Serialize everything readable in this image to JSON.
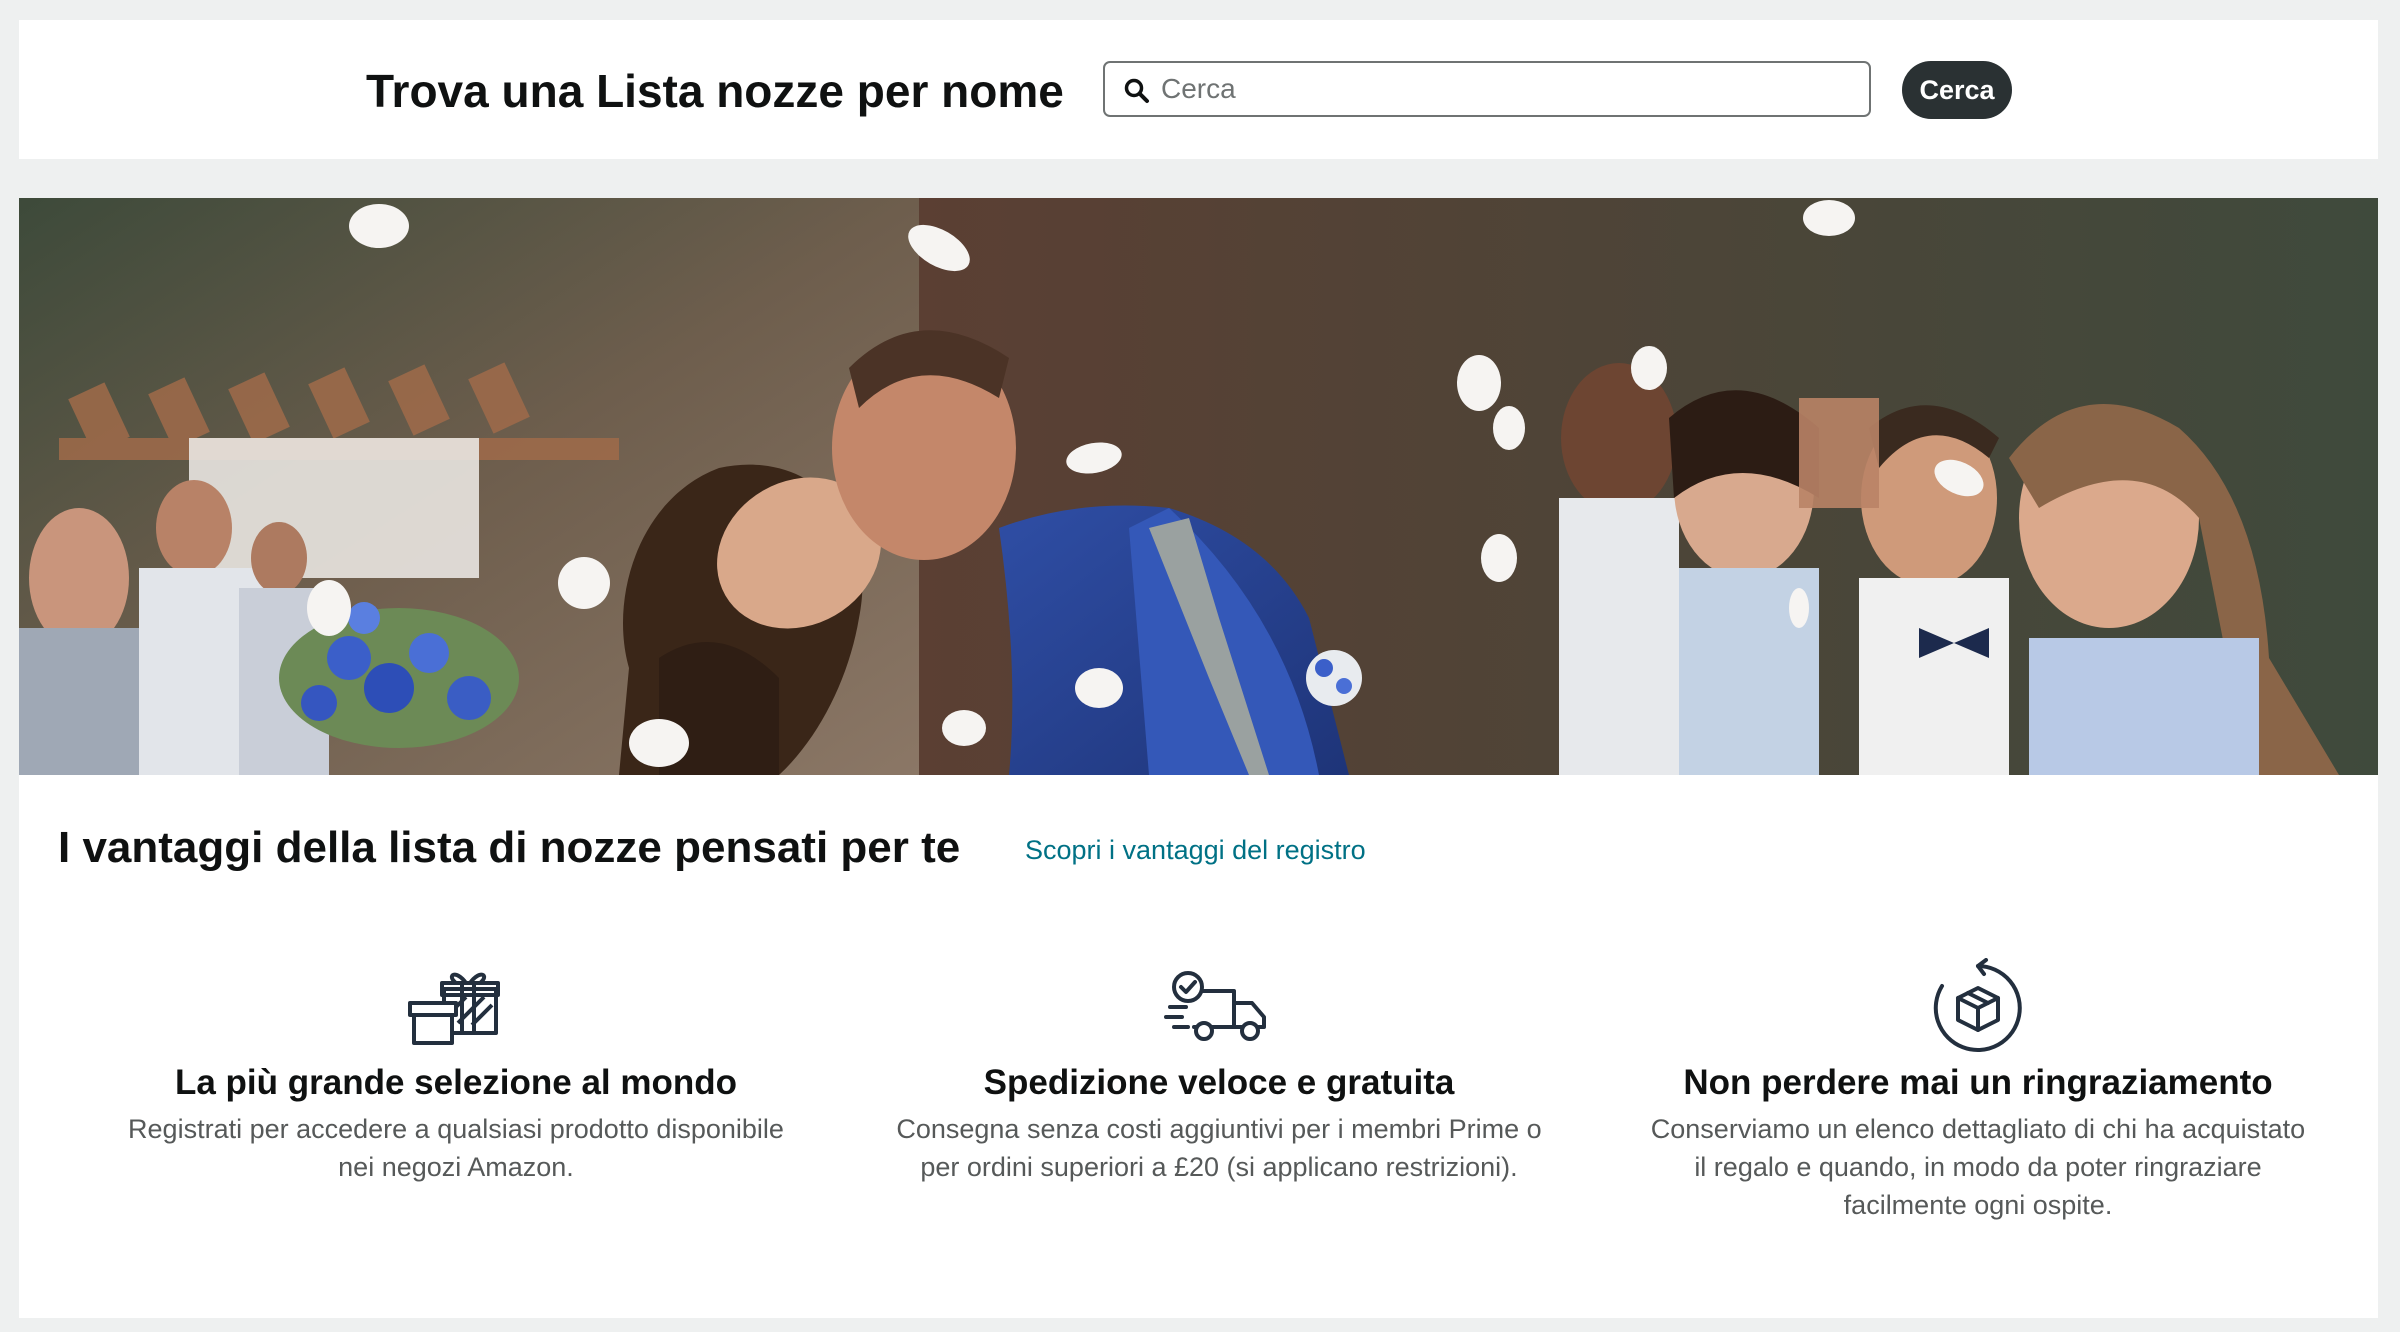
{
  "search": {
    "title": "Trova una Lista nozze per nome",
    "placeholder": "Cerca",
    "button_label": "Cerca"
  },
  "hero": {
    "image": "wedding-couple-kissing-photo"
  },
  "benefits": {
    "heading": "I vantaggi della lista di nozze pensati per te",
    "link_label": "Scopri i vantaggi del registro",
    "items": [
      {
        "icon": "gift-boxes-icon",
        "title": "La più grande selezione al mondo",
        "desc_line1": "Registrati per accedere a qualsiasi prodotto disponibile",
        "desc_line2": "nei negozi Amazon.",
        "desc_line3": ""
      },
      {
        "icon": "delivery-truck-icon",
        "title": "Spedizione veloce e gratuita",
        "desc_line1": "Consegna senza costi aggiuntivi per i membri Prime o",
        "desc_line2": "per ordini superiori a £20 (si applicano restrizioni).",
        "desc_line3": ""
      },
      {
        "icon": "package-return-icon",
        "title": "Non perdere mai un ringraziamento",
        "desc_line1": "Conserviamo un elenco dettagliato di chi ha acquistato",
        "desc_line2": "il regalo e quando, in modo da poter ringraziare",
        "desc_line3": "facilmente ogni ospite."
      }
    ]
  },
  "colors": {
    "link": "#007185",
    "button_bg": "#2a3133",
    "page_bg": "#eef0f0"
  }
}
